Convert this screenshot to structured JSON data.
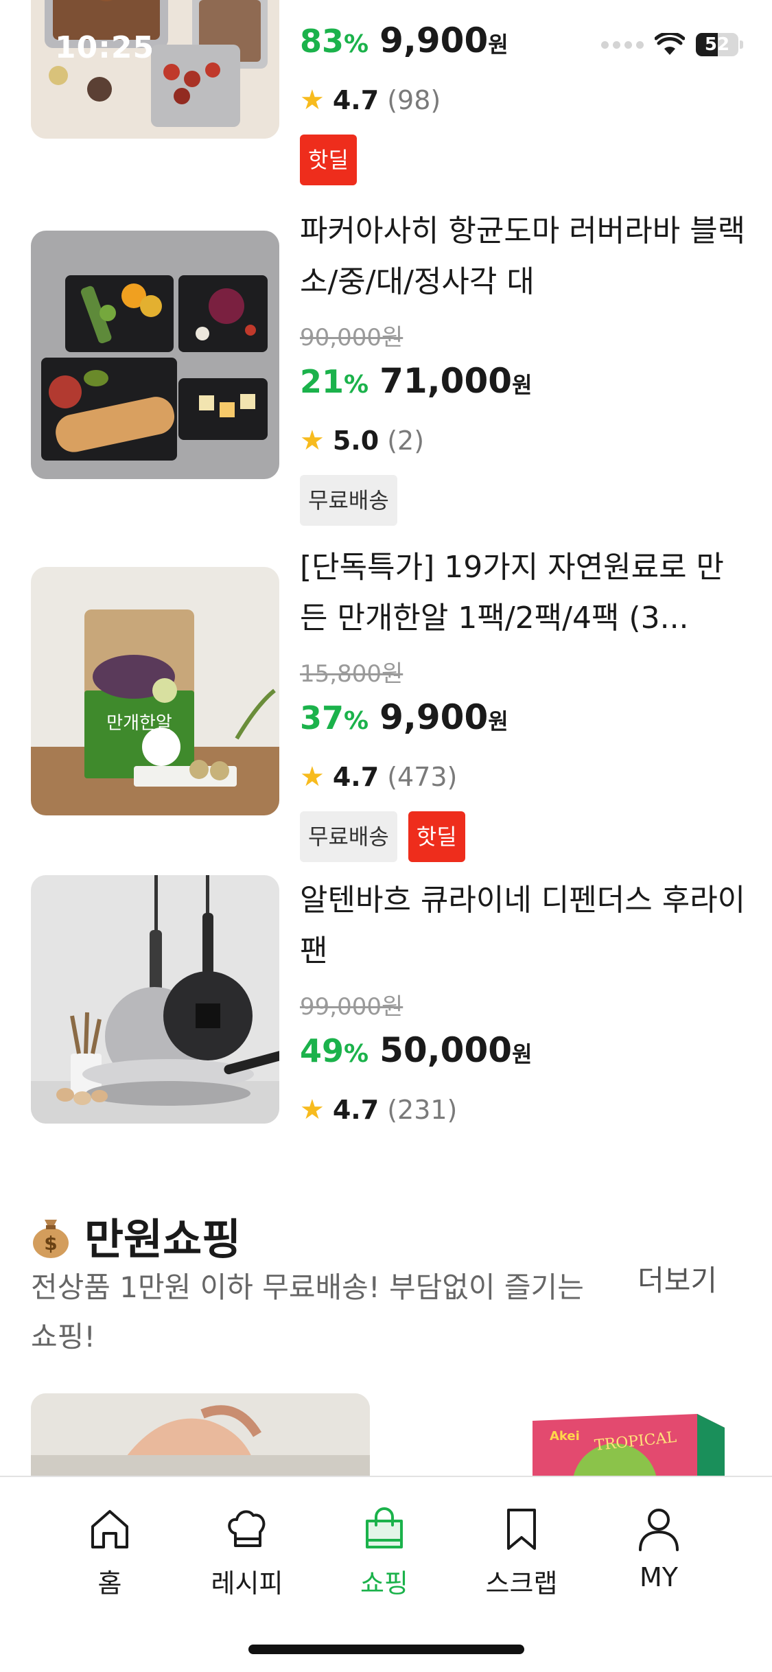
{
  "status_bar": {
    "time": "10:25",
    "battery": "52",
    "battery_level": 0.52
  },
  "products": [
    {
      "title": "",
      "original_price": "",
      "discount": "83",
      "discount_unit": "%",
      "price": "9,900",
      "price_unit": "원",
      "rating": "4.7",
      "review_count": "(98)",
      "tags": [
        "핫딜"
      ]
    },
    {
      "title": "파커아사히 항균도마 러버라바 블랙 소/중/대/정사각 대",
      "original_price": "90,000원",
      "discount": "21",
      "discount_unit": "%",
      "price": "71,000",
      "price_unit": "원",
      "rating": "5.0",
      "review_count": "(2)",
      "tags": [
        "무료배송"
      ]
    },
    {
      "title": "[단독특가] 19가지 자연원료로 만든 만개한알 1팩/2팩/4팩 (3...",
      "original_price": "15,800원",
      "discount": "37",
      "discount_unit": "%",
      "price": "9,900",
      "price_unit": "원",
      "rating": "4.7",
      "review_count": "(473)",
      "tags": [
        "무료배송",
        "핫딜"
      ],
      "image_text": "만개한알"
    },
    {
      "title": "알텐바흐 큐라이네 디펜더스 후라이팬",
      "original_price": "99,000원",
      "discount": "49",
      "discount_unit": "%",
      "price": "50,000",
      "price_unit": "원",
      "rating": "4.7",
      "review_count": "(231)",
      "tags": []
    }
  ],
  "section": {
    "title": "만원쇼핑",
    "description": "전상품 1만원 이하 무료배송! 부담없이 즐기는 쇼핑!",
    "more_label": "더보기",
    "promo_text": "TROPICAL",
    "promo_brand": "Akei"
  },
  "bottom_nav": {
    "items": [
      {
        "label": "홈",
        "icon": "home-icon",
        "active": false
      },
      {
        "label": "레시피",
        "icon": "chef-hat-icon",
        "active": false
      },
      {
        "label": "쇼핑",
        "icon": "shopping-bag-icon",
        "active": true
      },
      {
        "label": "스크랩",
        "icon": "bookmark-icon",
        "active": false
      },
      {
        "label": "MY",
        "icon": "person-icon",
        "active": false
      }
    ]
  },
  "colors": {
    "accent_green": "#1bb24b",
    "hot_deal_red": "#ee2d1c",
    "star_yellow": "#f7bb1e"
  }
}
